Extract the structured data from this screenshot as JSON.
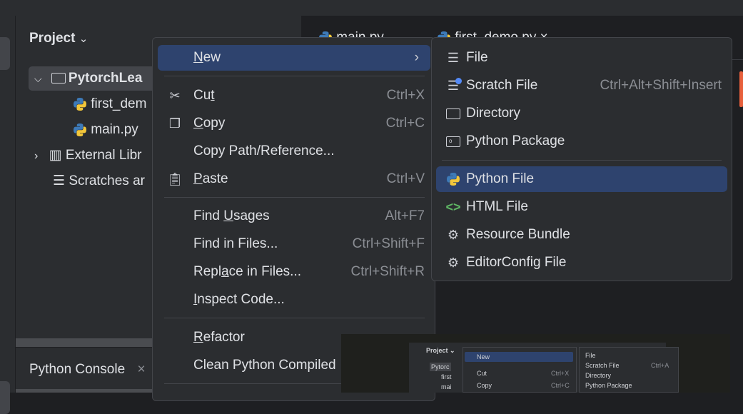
{
  "project_panel": {
    "title": "Project",
    "tree": [
      {
        "label": "PytorchLea",
        "type": "folder",
        "expanded": true
      },
      {
        "label": "first_dem",
        "type": "python"
      },
      {
        "label": "main.py",
        "type": "python"
      },
      {
        "label": "External Libr",
        "type": "library"
      },
      {
        "label": "Scratches ar",
        "type": "scratches"
      }
    ]
  },
  "bottom_panel": {
    "title": "Python Console",
    "close": "×"
  },
  "editor_tabs": [
    {
      "label": "main.py"
    },
    {
      "label": "first_demo.py"
    }
  ],
  "context_menu": {
    "items": [
      {
        "label": "New",
        "mnemonic": "N",
        "rest": "ew",
        "submenu": "›"
      },
      {
        "label": "Cut",
        "pre": "Cu",
        "mn": "t",
        "post": "",
        "shortcut": "Ctrl+X",
        "icon": "scissors-icon"
      },
      {
        "label": "Copy",
        "pre": "",
        "mn": "C",
        "post": "opy",
        "shortcut": "Ctrl+C",
        "icon": "copy-icon"
      },
      {
        "label": "Copy Path/Reference..."
      },
      {
        "label": "Paste",
        "pre": "",
        "mn": "P",
        "post": "aste",
        "shortcut": "Ctrl+V",
        "icon": "clipboard-icon"
      },
      {
        "label": "Find Usages",
        "pre": "Find ",
        "mn": "U",
        "post": "sages",
        "shortcut": "Alt+F7"
      },
      {
        "label": "Find in Files...",
        "shortcut": "Ctrl+Shift+F"
      },
      {
        "label": "Replace in Files...",
        "pre": "Repl",
        "mn": "a",
        "post": "ce in Files...",
        "shortcut": "Ctrl+Shift+R"
      },
      {
        "label": "Inspect Code...",
        "pre": "",
        "mn": "I",
        "post": "nspect Code..."
      },
      {
        "label": "Refactor",
        "pre": "",
        "mn": "R",
        "post": "efactor",
        "submenu": "›"
      },
      {
        "label": "Clean Python Compiled"
      }
    ]
  },
  "new_submenu": {
    "items": [
      {
        "label": "File",
        "icon": "text-file-icon"
      },
      {
        "label": "Scratch File",
        "shortcut": "Ctrl+Alt+Shift+Insert",
        "icon": "scratch-file-icon"
      },
      {
        "label": "Directory",
        "icon": "folder-icon"
      },
      {
        "label": "Python Package",
        "icon": "package-icon"
      },
      {
        "label": "Python File",
        "icon": "python-icon",
        "selected": true
      },
      {
        "label": "HTML File",
        "icon": "html-icon"
      },
      {
        "label": "Resource Bundle",
        "icon": "gear-icon"
      },
      {
        "label": "EditorConfig File",
        "icon": "gear-icon"
      }
    ]
  },
  "thumbnail": {
    "project": "Project ⌄",
    "tree": [
      "Pytorc",
      "first",
      "mai"
    ],
    "menu": [
      "New",
      "Cut",
      "Copy"
    ],
    "shortcuts": [
      "Ctrl+X",
      "Ctrl+C"
    ],
    "sub": [
      "File",
      "Scratch File",
      "Directory",
      "Python Package"
    ],
    "sub_shortcut": "Ctrl+A"
  },
  "colors": {
    "accent": "#2e436e",
    "background": "#2b2d30",
    "editor": "#1e1f22"
  }
}
